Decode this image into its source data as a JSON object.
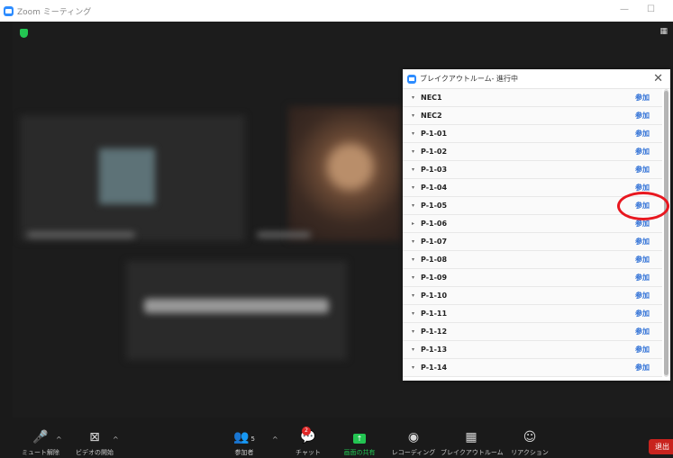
{
  "window": {
    "title": "Zoom ミーティング",
    "minimize": "—",
    "maximize": "☐"
  },
  "breakout_panel": {
    "title": "ブレイクアウトルーム- 進行中",
    "close": "✕",
    "join_label": "参加",
    "rooms": [
      {
        "name": "NEC1"
      },
      {
        "name": "NEC2"
      },
      {
        "name": "P-1-01"
      },
      {
        "name": "P-1-02"
      },
      {
        "name": "P-1-03"
      },
      {
        "name": "P-1-04"
      },
      {
        "name": "P-1-05"
      },
      {
        "name": "P-1-06"
      },
      {
        "name": "P-1-07"
      },
      {
        "name": "P-1-08"
      },
      {
        "name": "P-1-09"
      },
      {
        "name": "P-1-10"
      },
      {
        "name": "P-1-11"
      },
      {
        "name": "P-1-12"
      },
      {
        "name": "P-1-13"
      },
      {
        "name": "P-1-14"
      }
    ]
  },
  "toolbar": {
    "mute": "ミュート解除",
    "video": "ビデオの開始",
    "participants": "参加者",
    "participants_count": "5",
    "chat": "チャット",
    "chat_badge": "2",
    "share": "画面の共有",
    "record": "レコーディング",
    "breakout": "ブレイクアウトルーム",
    "reaction": "リアクション",
    "leave": "退出"
  },
  "colors": {
    "accent": "#2d8cff",
    "join_link": "#2d6fd6",
    "share_green": "#23c552",
    "leave_red": "#c8231e",
    "highlight": "#e8171f"
  }
}
